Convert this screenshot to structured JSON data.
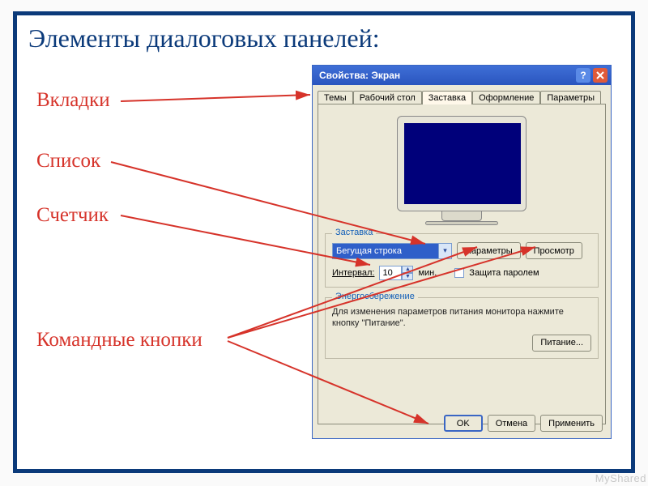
{
  "title": "Элементы диалоговых панелей:",
  "labels": {
    "tabs": "Вкладки",
    "list": "Список",
    "spinner": "Счетчик",
    "cmdButtons": "Командные кнопки"
  },
  "dialog": {
    "windowTitle": "Свойства: Экран",
    "tabs": [
      "Темы",
      "Рабочий стол",
      "Заставка",
      "Оформление",
      "Параметры"
    ],
    "screensaverGroup": {
      "title": "Заставка",
      "comboValue": "Бегущая строка",
      "paramsBtn": "Параметры",
      "previewBtn": "Просмотр",
      "intervalLabel": "Интервал:",
      "intervalValue": "10",
      "intervalUnit": "мин.",
      "passwordProtect": "Защита паролем"
    },
    "energyGroup": {
      "title": "Энергосбережение",
      "text": "Для изменения параметров питания монитора нажмите кнопку \"Питание\".",
      "powerBtn": "Питание..."
    },
    "actions": {
      "ok": "OK",
      "cancel": "Отмена",
      "apply": "Применить"
    }
  },
  "watermark": "MyShared"
}
